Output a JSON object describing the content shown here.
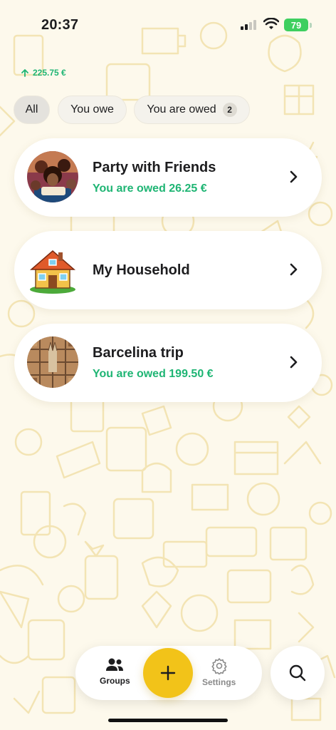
{
  "status": {
    "time": "20:37",
    "battery": "79"
  },
  "balance": {
    "amount": "225.75 €"
  },
  "filters": [
    {
      "label": "All",
      "active": true
    },
    {
      "label": "You owe",
      "active": false
    },
    {
      "label": "You are owed",
      "badge": "2",
      "active": false
    }
  ],
  "groups": [
    {
      "name": "Party with Friends",
      "status": "You are owed 26.25 €"
    },
    {
      "name": "My Household",
      "status": ""
    },
    {
      "name": "Barcelina trip",
      "status": "You are owed 199.50 €"
    }
  ],
  "nav": {
    "groups_label": "Groups",
    "settings_label": "Settings"
  },
  "colors": {
    "accent": "#f2c319",
    "positive": "#1fb574",
    "background": "#fdf9ec"
  },
  "icons": [
    "people-icon",
    "plus-icon",
    "gear-icon",
    "search-icon",
    "chevron-right-icon",
    "arrow-up-icon"
  ]
}
